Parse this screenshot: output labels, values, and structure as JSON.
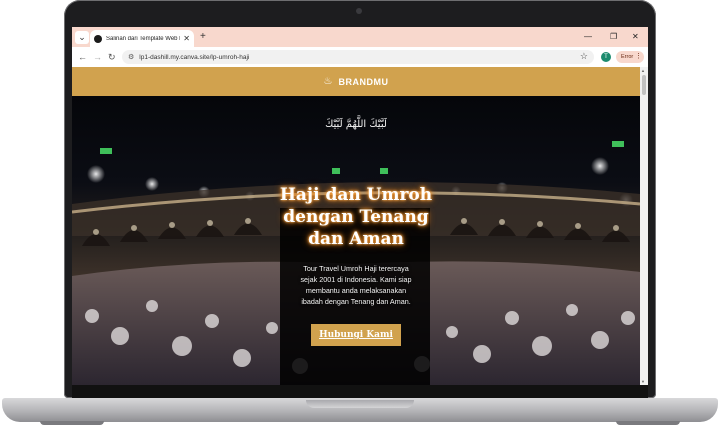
{
  "browser": {
    "tab_title": "Salinan dari Template Web Landing",
    "new_tab": "+",
    "menu": "⌄",
    "url": "lp1-dashill.my.canva.site/lp-umroh-haji",
    "profile_initial": "T",
    "error_label": "Error"
  },
  "page": {
    "brand": "BRANDMU",
    "arabic": "لَبَّيْكَ اللَّهُمَّ لَبَّيْكَ",
    "title_line1": "Haji dan Umroh",
    "title_line2": "dengan Tenang",
    "title_line3": "dan Aman",
    "subtitle_line1": "Tour Travel Umroh Haji terercaya",
    "subtitle_line2": "sejak 2001 di Indonesia. Kami siap",
    "subtitle_line3": "membantu anda melaksanakan",
    "subtitle_line4": "ibadah dengan Tenang dan Aman.",
    "cta_label": "Hubungi Kami",
    "accent_color": "#d1a24e",
    "tab_strip_color": "#f8d8cd"
  }
}
